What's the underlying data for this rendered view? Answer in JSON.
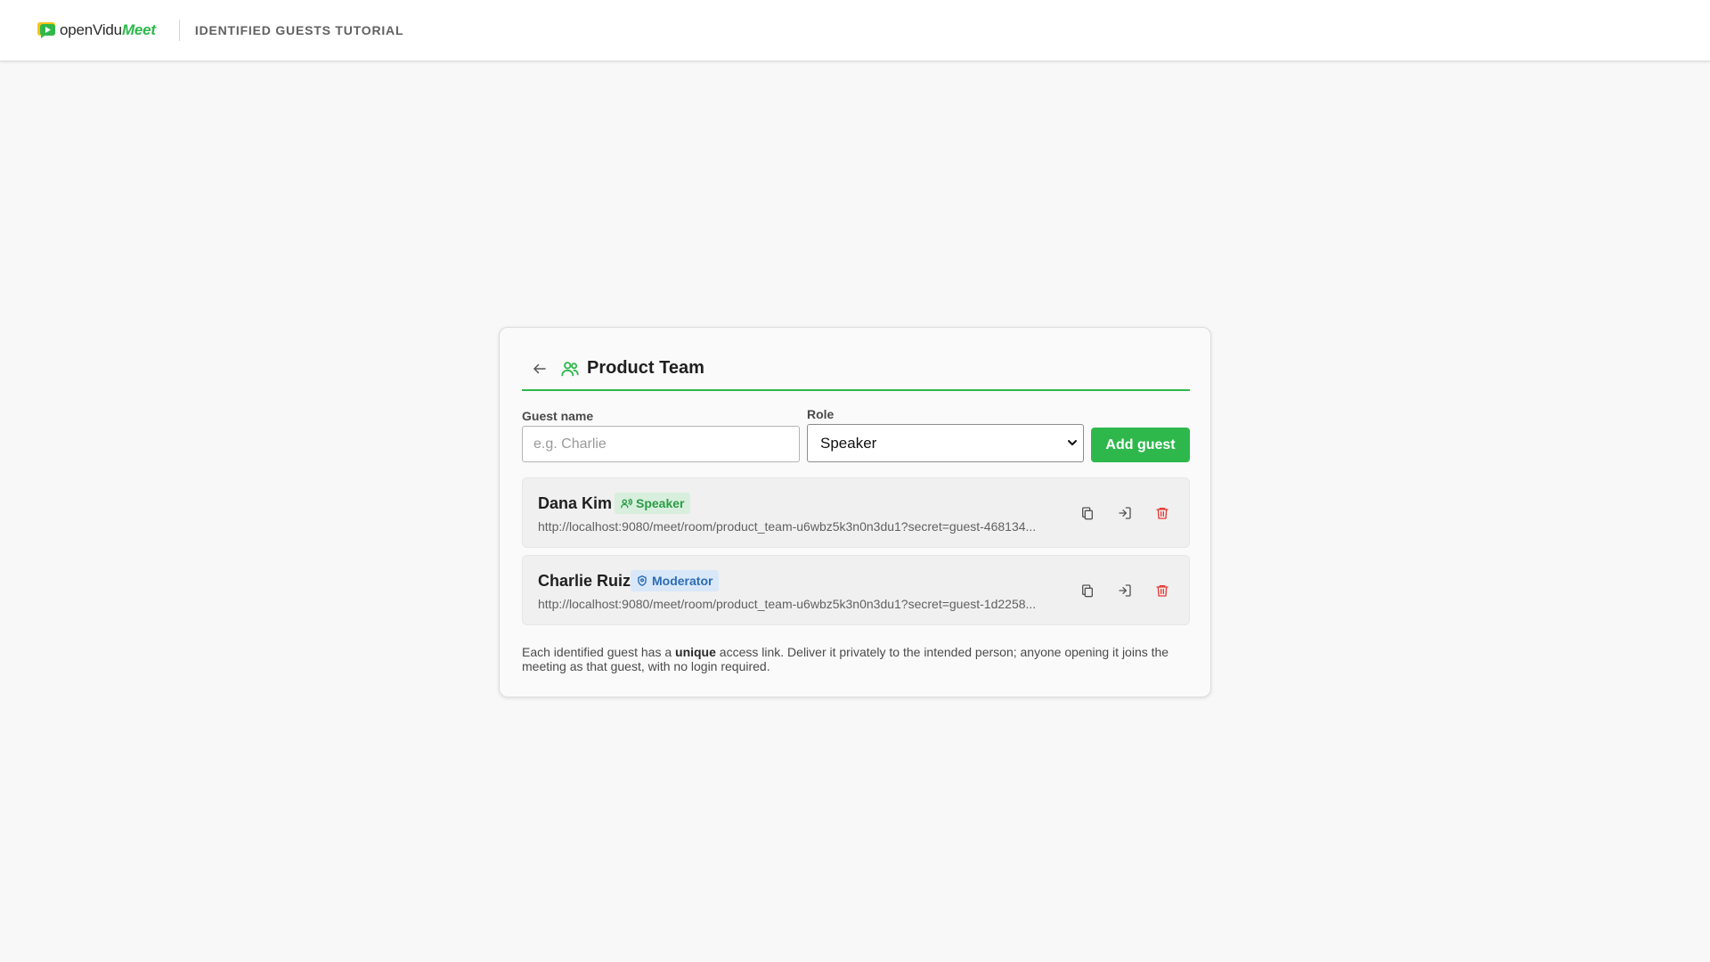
{
  "header": {
    "brand_open": "openVidu",
    "brand_meet": "Meet",
    "title": "IDENTIFIED GUESTS TUTORIAL"
  },
  "card": {
    "title": "Product Team",
    "back_icon": "arrow-left-icon",
    "team_icon": "users-icon"
  },
  "form": {
    "guest_name_label": "Guest name",
    "guest_name_placeholder": "e.g. Charlie",
    "guest_name_value": "",
    "role_label": "Role",
    "role_selected": "Speaker",
    "add_button": "Add guest"
  },
  "guests": [
    {
      "name": "Dana Kim",
      "role": "Speaker",
      "role_icon": "speaker-users-icon",
      "link": "http://localhost:9080/meet/room/product_team-u6wbz5k3n0n3du1?secret=guest-468134..."
    },
    {
      "name": "Charlie Ruiz",
      "role": "Moderator",
      "role_icon": "shield-icon",
      "link": "http://localhost:9080/meet/room/product_team-u6wbz5k3n0n3du1?secret=guest-1d2258..."
    }
  ],
  "footnote": {
    "before": "Each identified guest has a ",
    "bold": "unique",
    "after": " access link. Deliver it privately to the intended person; anyone opening it joins the meeting as that guest, with no login required."
  },
  "colors": {
    "accent": "#2eb84c",
    "delete": "#e53935",
    "speaker_badge_bg": "#d8efdd",
    "moderator_badge_bg": "#d9e8f8",
    "moderator_text": "#2c6cb5"
  }
}
